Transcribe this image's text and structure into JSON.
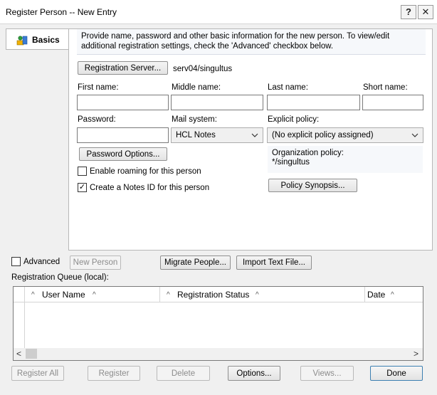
{
  "window": {
    "title": "Register Person -- New Entry",
    "help_label": "?",
    "close_label": "✕"
  },
  "tabs": [
    {
      "label": "Basics"
    }
  ],
  "intro_text": "Provide name, password and other basic information for the new person.  To view/edit additional registration settings, check the 'Advanced' checkbox below.",
  "registration_server": {
    "button_label": "Registration Server...",
    "value": "serv04/singultus"
  },
  "name_fields": {
    "first_label": "First name:",
    "middle_label": "Middle name:",
    "last_label": "Last name:",
    "short_label": "Short name:"
  },
  "password": {
    "label": "Password:"
  },
  "mail_system": {
    "label": "Mail system:",
    "value": "HCL Notes"
  },
  "explicit_policy": {
    "label": "Explicit policy:",
    "value": "(No explicit policy assigned)"
  },
  "password_options_label": "Password Options...",
  "org_policy": {
    "label": "Organization policy:",
    "value": "*/singultus"
  },
  "policy_synopsis_label": "Policy Synopsis...",
  "enable_roaming": {
    "label": "Enable roaming for this person",
    "checked": false
  },
  "create_id": {
    "label": "Create a Notes ID for this person",
    "checked": true,
    "check_glyph": "✓"
  },
  "advanced": {
    "label": "Advanced",
    "checked": false
  },
  "action_buttons": {
    "new_person": "New Person",
    "migrate_people": "Migrate People...",
    "import_text": "Import Text File..."
  },
  "queue": {
    "label": "Registration Queue (local):",
    "columns": [
      "User Name",
      "Registration Status",
      "Date"
    ],
    "sort_glyph": "^",
    "scroll_left": "<",
    "scroll_right": ">"
  },
  "footer_buttons": {
    "register_all": "Register All",
    "register": "Register",
    "delete": "Delete",
    "options": "Options...",
    "views": "Views...",
    "done": "Done"
  }
}
